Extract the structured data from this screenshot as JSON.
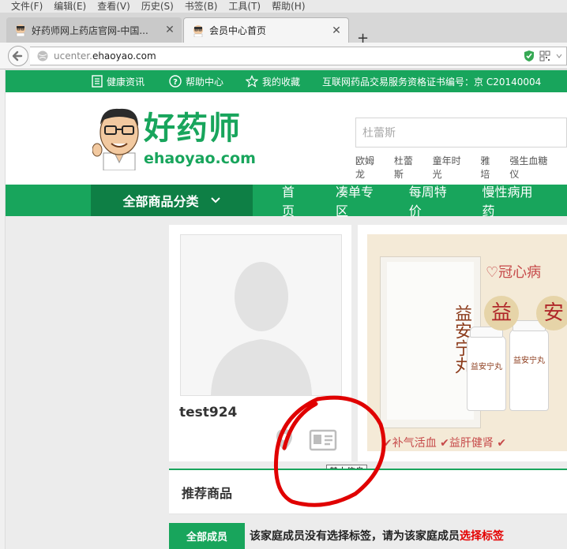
{
  "browser": {
    "menu": [
      "文件(F)",
      "编辑(E)",
      "查看(V)",
      "历史(S)",
      "书签(B)",
      "工具(T)",
      "帮助(H)"
    ],
    "tabs": [
      {
        "title": "好药师网上药店官网-中国...",
        "active": false
      },
      {
        "title": "会员中心首页",
        "active": true
      }
    ],
    "new_tab": "+",
    "url_prefix": "ucenter.",
    "url_domain": "ehaoyao.com"
  },
  "topbar": {
    "items": [
      "健康资讯",
      "帮助中心",
      "我的收藏"
    ],
    "license": "互联网药品交易服务资格证书编号：京 C20140004"
  },
  "header": {
    "logo_cn": "好药师",
    "logo_en": "ehaoyao.com",
    "search_placeholder": "杜蕾斯",
    "hot_words": [
      "欧姆龙",
      "杜蕾斯",
      "童年时光",
      "雅培",
      "强生血糖仪"
    ]
  },
  "mainnav": {
    "all_categories": "全部商品分类",
    "links": [
      "首 页",
      "凑单专区",
      "每周特价",
      "慢性病用药"
    ]
  },
  "member": {
    "username": "test924",
    "tooltip": "基本信息"
  },
  "banner": {
    "title": "♡冠心病",
    "product": "益安宁丸",
    "bottle_label": "益安宁丸",
    "seals": [
      "益",
      "安"
    ],
    "benefits": "✔补气活血 ✔益肝健肾 ✔"
  },
  "recommend": {
    "title": "推荐商品",
    "all_members": "全部成员",
    "notice_text": "该家庭成员没有选择标签，请为该家庭成员",
    "notice_link": "选择标签"
  },
  "colors": {
    "brand_green": "#18a55c",
    "dark_green": "#0e7f45",
    "link_red": "#e40000"
  }
}
